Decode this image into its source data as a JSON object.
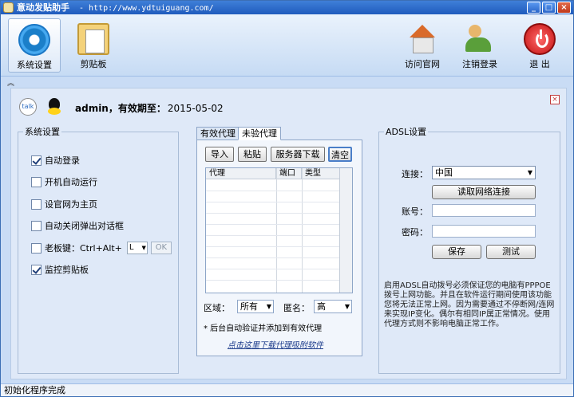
{
  "window": {
    "title": "意动发贴助手",
    "url": " - http://www.ydtuiguang.com/"
  },
  "toolbar": {
    "settings": "系统设置",
    "clipboard": "剪贴板",
    "visit_site": "访问官网",
    "logout": "注销登录",
    "exit": "退  出"
  },
  "user": {
    "talk_badge": "talk",
    "name_label": "admin，有效期至：",
    "expiry": "2015-05-02"
  },
  "system_settings": {
    "legend": "系统设置",
    "items": [
      {
        "label": "自动登录",
        "checked": true
      },
      {
        "label": "开机自动运行",
        "checked": false
      },
      {
        "label": "设官网为主页",
        "checked": false
      },
      {
        "label": "自动关闭弹出对话框",
        "checked": false
      },
      {
        "label": "老板键：Ctrl+Alt+",
        "checked": false
      },
      {
        "label": "监控剪贴板",
        "checked": true
      }
    ],
    "boss_key_value": "L",
    "ok_label": "OK"
  },
  "proxy": {
    "tabs": [
      "有效代理",
      "未验代理"
    ],
    "buttons": [
      "导入",
      "粘贴",
      "服务器下载",
      "清空"
    ],
    "columns": [
      "代理",
      "端口",
      "类型"
    ],
    "region_label": "区域：",
    "region_value": "所有",
    "anon_label": "匿名：",
    "anon_value": "高",
    "note": "* 后台自动验证并添加到有效代理",
    "download_link": "点击这里下载代理吸附软件"
  },
  "adsl": {
    "legend": "ADSL设置",
    "connect_label": "连接：",
    "connect_value": "中国",
    "read_button": "读取网络连接",
    "account_label": "账号：",
    "account_value": "",
    "password_label": "密码：",
    "password_value": "",
    "save_button": "保存",
    "test_button": "测试",
    "note": "启用ADSL自动拨号必须保证您的电脑有PPPOE拨号上网功能。并且在软件运行期间使用该功能您将无法正常上网。因为需要通过不停断网/连网来实现IP变化。偶尔有相同IP属正常情况。使用代理方式则不影响电脑正常工作。"
  },
  "status": {
    "text": "初始化程序完成"
  }
}
